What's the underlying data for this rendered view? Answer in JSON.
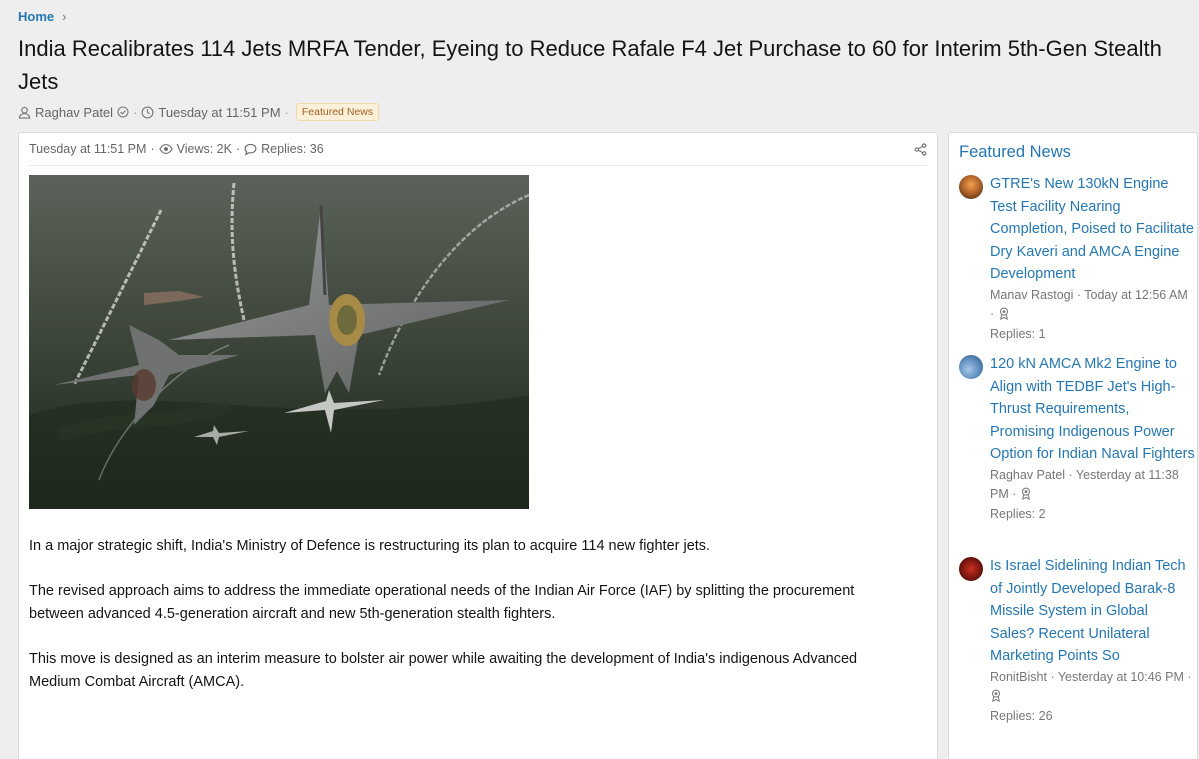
{
  "breadcrumb": {
    "home": "Home"
  },
  "thread": {
    "title": "India Recalibrates 114 Jets MRFA Tender, Eyeing to Reduce Rafale F4 Jet Purchase to 60 for Interim 5th-Gen Stealth Jets",
    "author": "Raghav Patel",
    "date": "Tuesday at 11:51 PM",
    "prefix": "Featured News"
  },
  "post": {
    "date": "Tuesday at 11:51 PM",
    "views": "Views: 2K",
    "replies": "Replies: 36",
    "paragraphs": [
      "In a major strategic shift, India's Ministry of Defence is restructuring its plan to acquire 114 new fighter jets.",
      "The revised approach aims to address the immediate operational needs of the Indian Air Force (IAF) by splitting the procurement between advanced 4.5-generation aircraft and new 5th-generation stealth fighters.",
      "This move is designed as an interim measure to bolster air power while awaiting the development of India's indigenous Advanced Medium Combat Aircraft (AMCA)."
    ]
  },
  "sidebar": {
    "title": "Featured News",
    "items": [
      {
        "title": "GTRE's New 130kN Engine Test Facility Nearing Completion, Poised to Facilitate Dry Kaveri and AMCA Engine Development",
        "meta": "Manav Rastogi · Today at 12:56 AM ·",
        "replies": "Replies: 1",
        "avatar_color": "#b5652a"
      },
      {
        "title": "120 kN AMCA Mk2 Engine to Align with TEDBF Jet's High-Thrust Requirements, Promising Indigenous Power Option for Indian Naval Fighters",
        "meta": "Raghav Patel · Yesterday at 11:38 PM ·",
        "replies": "Replies: 2",
        "avatar_color": "#5f8fbf"
      },
      {
        "title": "Is Israel Sidelining Indian Tech of Jointly Developed Barak-8 Missile System in Global Sales? Recent Unilateral Marketing Points So",
        "meta": "RonitBisht · Yesterday at 10:46 PM ·",
        "replies": "Replies: 26",
        "avatar_color": "#8a1a12"
      }
    ]
  }
}
